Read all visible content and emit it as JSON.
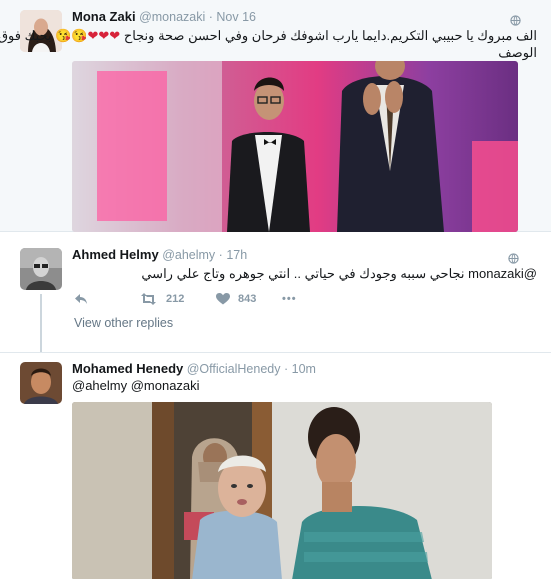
{
  "tweets": [
    {
      "name": "Mona Zaki",
      "handle": "@monazaki",
      "separator": "·",
      "time": "Nov 16",
      "text_line1": "الف مبروك يا حبيبي التكريم.دايما يارب اشوفك فرحان وفي احسن صحة ونجاح",
      "emoji": "❤❤❤😘😘",
      "text_line1_end": "بحبك فوق",
      "text_line2": "الوصف"
    },
    {
      "name": "Ahmed Helmy",
      "handle": "@ahelmy",
      "separator": "·",
      "time": "17h",
      "text": "@monazaki نجاحي سببه وجودك في حياتي .. انتي جوهره وتاج علي راسي",
      "retweets": "212",
      "likes": "843",
      "more": "•••",
      "view_replies": "View other replies"
    },
    {
      "name": "Mohamed Henedy",
      "handle": "@OfficialHenedy",
      "separator": "·",
      "time": "10m",
      "text": "@ahelmy @monazaki"
    }
  ],
  "icons": {
    "globe": "globe-icon",
    "reply": "reply-icon",
    "retweet": "retweet-icon",
    "like": "heart-icon",
    "more": "more-icon"
  },
  "colors": {
    "muted": "#8899a6",
    "heart": "#d7233a",
    "tweet_bg": "#f5f8fa",
    "border": "#e1e8ed"
  }
}
